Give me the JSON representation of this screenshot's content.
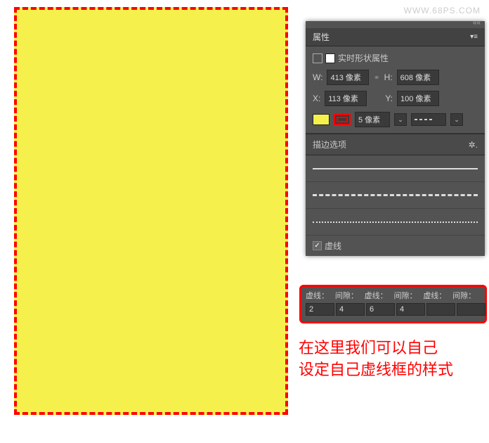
{
  "watermark": "WWW.68PS.COM",
  "canvas": {
    "fill": "#f6f04d",
    "stroke": "#ff0000"
  },
  "panel": {
    "title": "属性",
    "shape_header": "实时形状属性",
    "w_label": "W:",
    "w_value": "413 像素",
    "h_label": "H:",
    "h_value": "608 像素",
    "x_label": "X:",
    "x_value": "113 像素",
    "y_label": "Y:",
    "y_value": "100 像素",
    "stroke_width": "5 像素",
    "stroke_options_title": "描边选项",
    "dashed_label": "虚线"
  },
  "dash": {
    "labels": [
      "虚线：",
      "间隙：",
      "虚线：",
      "间隙：",
      "虚线：",
      "间隙："
    ],
    "values": [
      "2",
      "4",
      "6",
      "4",
      "",
      ""
    ]
  },
  "annotation": {
    "line1": "在这里我们可以自己",
    "line2": "设定自己虚线框的样式"
  }
}
